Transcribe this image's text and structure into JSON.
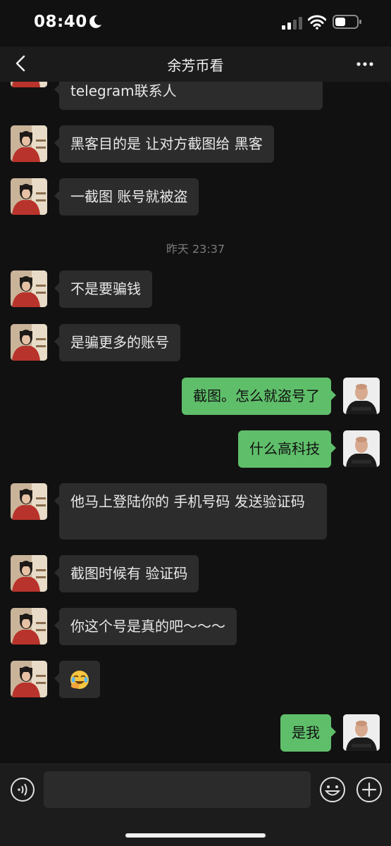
{
  "status_bar": {
    "time": "08:40"
  },
  "nav": {
    "title": "余芳币看"
  },
  "messages": [
    {
      "text": "telegram联系人"
    },
    {
      "text": "黑客目的是 让对方截图给 黑客"
    },
    {
      "text": "一截图 账号就被盗"
    },
    {
      "text": "不是要骗钱"
    },
    {
      "text": "是骗更多的账号"
    },
    {
      "text": "截图。怎么就盗号了"
    },
    {
      "text": "什么高科技"
    },
    {
      "text": "他马上登陆你的 手机号码 发送验证码"
    },
    {
      "text": "截图时候有 验证码"
    },
    {
      "text": "你这个号是真的吧～～～"
    },
    {
      "emoji": "facepalm-laugh-emoji"
    },
    {
      "text": "是我"
    }
  ],
  "timestamp": {
    "text": "昨天 23:37"
  },
  "input": {
    "value": ""
  },
  "icons": {
    "back": "chevron-left-icon",
    "more": "more-dots-icon",
    "voice": "voice-icon",
    "emoji": "emoji-icon",
    "plus": "plus-icon"
  },
  "colors": {
    "outgoing_bubble": "#5fbe6a",
    "incoming_bubble": "#2c2c2c",
    "background": "#111111"
  }
}
